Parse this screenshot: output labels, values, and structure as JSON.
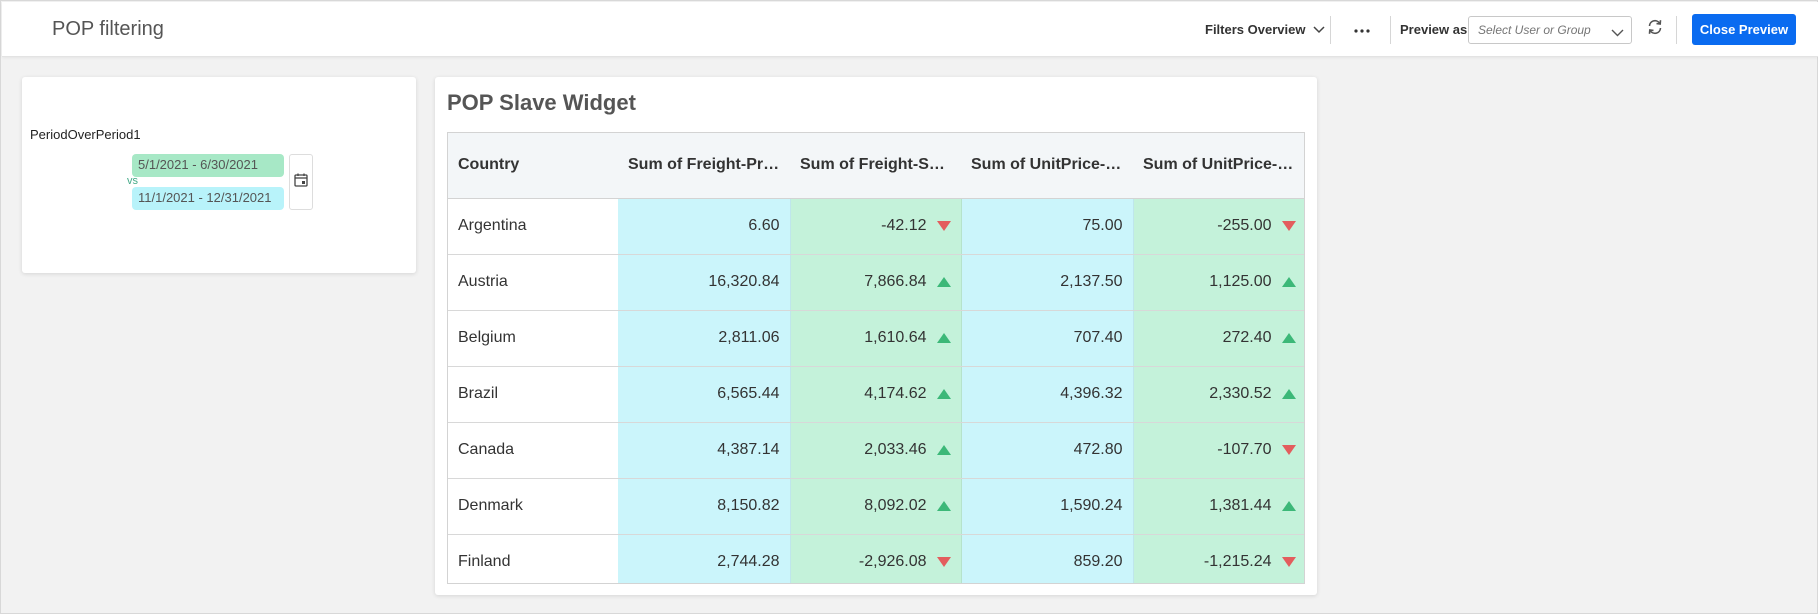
{
  "header": {
    "title": "POP filtering",
    "filters_overview": "Filters Overview",
    "more_label": "···",
    "preview_as_label": "Preview as",
    "preview_placeholder": "Select User or Group",
    "close_preview": "Close Preview"
  },
  "filter": {
    "name": "PeriodOverPeriod1",
    "primary_range": "5/1/2021 - 6/30/2021",
    "vs_label": "vs",
    "secondary_range": "11/1/2021 - 12/31/2021"
  },
  "widget": {
    "title": "POP Slave Widget",
    "columns": [
      "Country",
      "Sum of Freight-Primary",
      "Sum of Freight-Secondary",
      "Sum of UnitPrice-Primary",
      "Sum of UnitPrice-Secondary"
    ],
    "rows": [
      {
        "country": "Argentina",
        "freight_primary": "6.60",
        "freight_secondary": "-42.12",
        "freight_trend": "down",
        "unitprice_primary": "75.00",
        "unitprice_secondary": "-255.00",
        "unitprice_trend": "down"
      },
      {
        "country": "Austria",
        "freight_primary": "16,320.84",
        "freight_secondary": "7,866.84",
        "freight_trend": "up",
        "unitprice_primary": "2,137.50",
        "unitprice_secondary": "1,125.00",
        "unitprice_trend": "up"
      },
      {
        "country": "Belgium",
        "freight_primary": "2,811.06",
        "freight_secondary": "1,610.64",
        "freight_trend": "up",
        "unitprice_primary": "707.40",
        "unitprice_secondary": "272.40",
        "unitprice_trend": "up"
      },
      {
        "country": "Brazil",
        "freight_primary": "6,565.44",
        "freight_secondary": "4,174.62",
        "freight_trend": "up",
        "unitprice_primary": "4,396.32",
        "unitprice_secondary": "2,330.52",
        "unitprice_trend": "up"
      },
      {
        "country": "Canada",
        "freight_primary": "4,387.14",
        "freight_secondary": "2,033.46",
        "freight_trend": "up",
        "unitprice_primary": "472.80",
        "unitprice_secondary": "-107.70",
        "unitprice_trend": "down"
      },
      {
        "country": "Denmark",
        "freight_primary": "8,150.82",
        "freight_secondary": "8,092.02",
        "freight_trend": "up",
        "unitprice_primary": "1,590.24",
        "unitprice_secondary": "1,381.44",
        "unitprice_trend": "up"
      },
      {
        "country": "Finland",
        "freight_primary": "2,744.28",
        "freight_secondary": "-2,926.08",
        "freight_trend": "down",
        "unitprice_primary": "859.20",
        "unitprice_secondary": "-1,215.24",
        "unitprice_trend": "down"
      }
    ]
  },
  "icons": {
    "chevron": "chevron-down-icon",
    "more": "more-horizontal-icon",
    "refresh": "refresh-icon",
    "calendar": "calendar-icon",
    "up": "triangle-up-icon",
    "down": "triangle-down-icon"
  },
  "colors": {
    "accent": "#0a6bf0",
    "primary_period": "#cbf5fb",
    "secondary_period": "#c4f2da",
    "primary_pill": "#a7e8c6",
    "secondary_pill": "#b8f3fa",
    "trend_up": "#3cb878",
    "trend_down": "#e35d5d"
  }
}
